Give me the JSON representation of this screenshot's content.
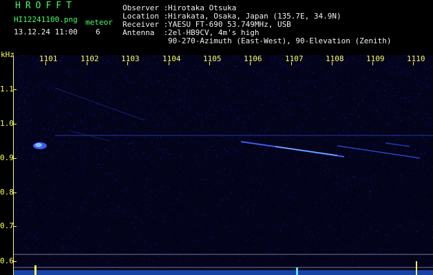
{
  "header": {
    "brand": "HROFFT",
    "filename": "HI12241100.png",
    "datetime": "13.12.24 11:00",
    "meteor_label": "meteor",
    "meteor_count": "6",
    "info": {
      "observer_label": "Observer :",
      "observer_value": "Hirotaka Otsuka",
      "location_label": "Location :",
      "location_value": "Hirakata, Osaka, Japan (135.7E, 34.9N)",
      "receiver_label": "Receiver :",
      "receiver_value": "YAESU FT-690 53.749MHz, USB",
      "antenna_label": "Antenna  :",
      "antenna_value": "2el-HB9CV, 4m's high",
      "antenna_value2": "90-270-Azimuth (East-West), 90-Elevation (Zenith)"
    }
  },
  "axes": {
    "y_unit": "kHz",
    "y_ticks": [
      "1.1",
      "1.0",
      "0.9",
      "0.8",
      "0.7",
      "0.6"
    ],
    "x_ticks": [
      "1101",
      "1102",
      "1103",
      "1104",
      "1105",
      "1106",
      "1107",
      "1108",
      "1109",
      "1110"
    ]
  },
  "colors": {
    "background": "#000000",
    "label_green": "#44ff66",
    "label_white": "#f2f2f2",
    "axis_yellow": "#ffff55",
    "signal_blue": "#4466ff",
    "signal_cyan": "#55ddff"
  }
}
